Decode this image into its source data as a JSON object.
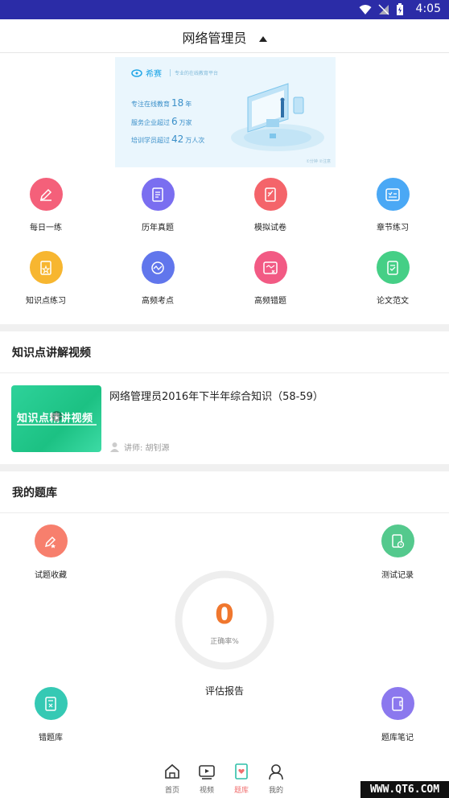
{
  "status_bar": {
    "time": "4:05"
  },
  "header": {
    "title": "网络管理员"
  },
  "banner": {
    "brand": "希赛",
    "tagline": "专业的在线教育平台",
    "lines": [
      {
        "prefix": "专注在线教育",
        "value": "18",
        "suffix": "年"
      },
      {
        "prefix": "服务企业超过",
        "value": "6",
        "suffix": "万家"
      },
      {
        "prefix": "培训学员超过",
        "value": "42",
        "suffix": "万人次"
      }
    ],
    "footnote": "①分钟  ②注意"
  },
  "features": [
    {
      "label": "每日一练",
      "icon": "pencil-icon",
      "color": "#f4607a"
    },
    {
      "label": "历年真题",
      "icon": "document-list-icon",
      "color": "#7a6ef0"
    },
    {
      "label": "模拟试卷",
      "icon": "exam-paper-icon",
      "color": "#f4646a"
    },
    {
      "label": "章节练习",
      "icon": "checklist-icon",
      "color": "#4aa8f5"
    },
    {
      "label": "知识点练习",
      "icon": "star-document-icon",
      "color": "#f7b630"
    },
    {
      "label": "高频考点",
      "icon": "chart-wave-icon",
      "color": "#6176ec"
    },
    {
      "label": "高频错题",
      "icon": "error-card-icon",
      "color": "#f25a84"
    },
    {
      "label": "论文范文",
      "icon": "essay-icon",
      "color": "#45cf86"
    }
  ],
  "video_section": {
    "title": "知识点讲解视频",
    "thumb_text": "知识点精讲视频",
    "video_title": "网络管理员2016年下半年综合知识（58-59）",
    "teacher": "讲师: 胡钊源"
  },
  "library_section": {
    "title": "我的题库",
    "items": [
      {
        "label": "试题收藏",
        "icon": "star-pencil-icon",
        "color": "#f77f6d"
      },
      {
        "label": "测试记录",
        "icon": "clock-document-icon",
        "color": "#54c98d"
      },
      {
        "label": "错题库",
        "icon": "wrong-book-icon",
        "color": "#35c9b4"
      },
      {
        "label": "题库笔记",
        "icon": "notebook-icon",
        "color": "#8b78ee"
      }
    ],
    "accuracy_value": "0",
    "accuracy_label": "正确率%",
    "report_label": "评估报告"
  },
  "tabbar": {
    "tabs": [
      {
        "label": "首页",
        "icon": "home-icon",
        "active": false
      },
      {
        "label": "视频",
        "icon": "video-play-icon",
        "active": false
      },
      {
        "label": "题库",
        "icon": "question-bank-icon",
        "active": true
      },
      {
        "label": "我的",
        "icon": "profile-icon",
        "active": false
      }
    ]
  },
  "watermark": "WWW.QT6.COM"
}
